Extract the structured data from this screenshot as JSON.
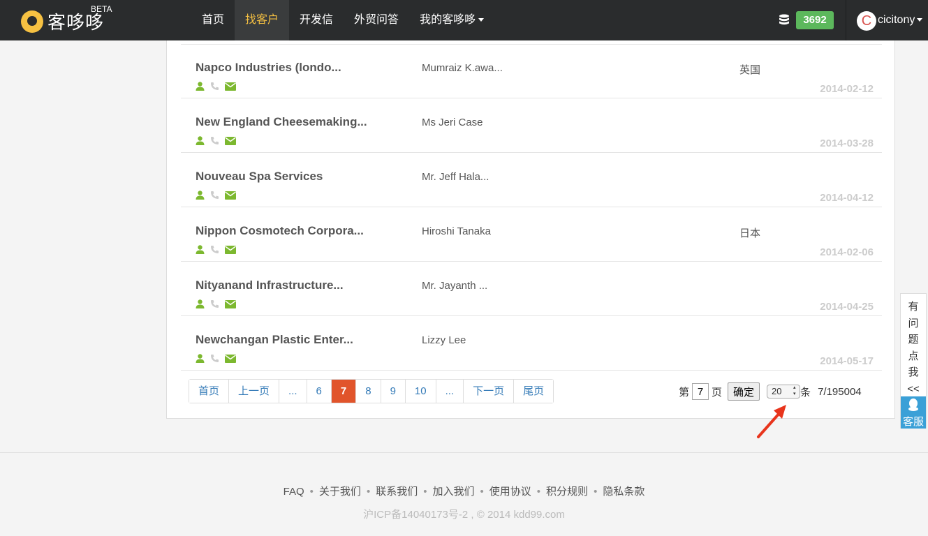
{
  "app": {
    "logo_text": "客哆哆",
    "beta": "BETA"
  },
  "nav": {
    "items": [
      {
        "label": "首页"
      },
      {
        "label": "找客户"
      },
      {
        "label": "开发信"
      },
      {
        "label": "外贸问答"
      },
      {
        "label": "我的客哆哆"
      }
    ],
    "points": "3692",
    "avatar_letter": "C",
    "username": "cicitony"
  },
  "rows": [
    {
      "company": "Napco Industries (londo...",
      "contact": "Mumraiz K.awa...",
      "country": "英国",
      "date": "2014-02-12"
    },
    {
      "company": "New England Cheesemaking...",
      "contact": "Ms Jeri Case",
      "country": "",
      "date": "2014-03-28"
    },
    {
      "company": "Nouveau Spa Services",
      "contact": "Mr. Jeff Hala...",
      "country": "",
      "date": "2014-04-12"
    },
    {
      "company": "Nippon Cosmotech Corpora...",
      "contact": "Hiroshi Tanaka",
      "country": "日本",
      "date": "2014-02-06"
    },
    {
      "company": "Nityanand Infrastructure...",
      "contact": "Mr. Jayanth ...",
      "country": "",
      "date": "2014-04-25"
    },
    {
      "company": "Newchangan Plastic Enter...",
      "contact": "Lizzy Lee",
      "country": "",
      "date": "2014-05-17"
    }
  ],
  "pagination": {
    "first": "首页",
    "prev": "上一页",
    "ellipsis": "...",
    "pages": [
      "6",
      "7",
      "8",
      "9",
      "10"
    ],
    "next": "下一页",
    "last": "尾页",
    "goto_prefix": "第",
    "goto_value": "7",
    "goto_suffix": "页",
    "confirm": "确定",
    "page_size": "20",
    "page_size_suffix": "条",
    "total": "7/195004"
  },
  "side": {
    "text": "有问题点我<<",
    "button": "客服"
  },
  "footer": {
    "links": [
      "FAQ",
      "关于我们",
      "联系我们",
      "加入我们",
      "使用协议",
      "积分规则",
      "隐私条款"
    ],
    "copyright": "沪ICP备14040173号-2 , © 2014 kdd99.com"
  },
  "colors": {
    "accent": "#f6c142",
    "active_page": "#e1542b",
    "icon_green": "#7cb82f",
    "badge_green": "#5cb85c",
    "link_blue": "#337ab7"
  }
}
